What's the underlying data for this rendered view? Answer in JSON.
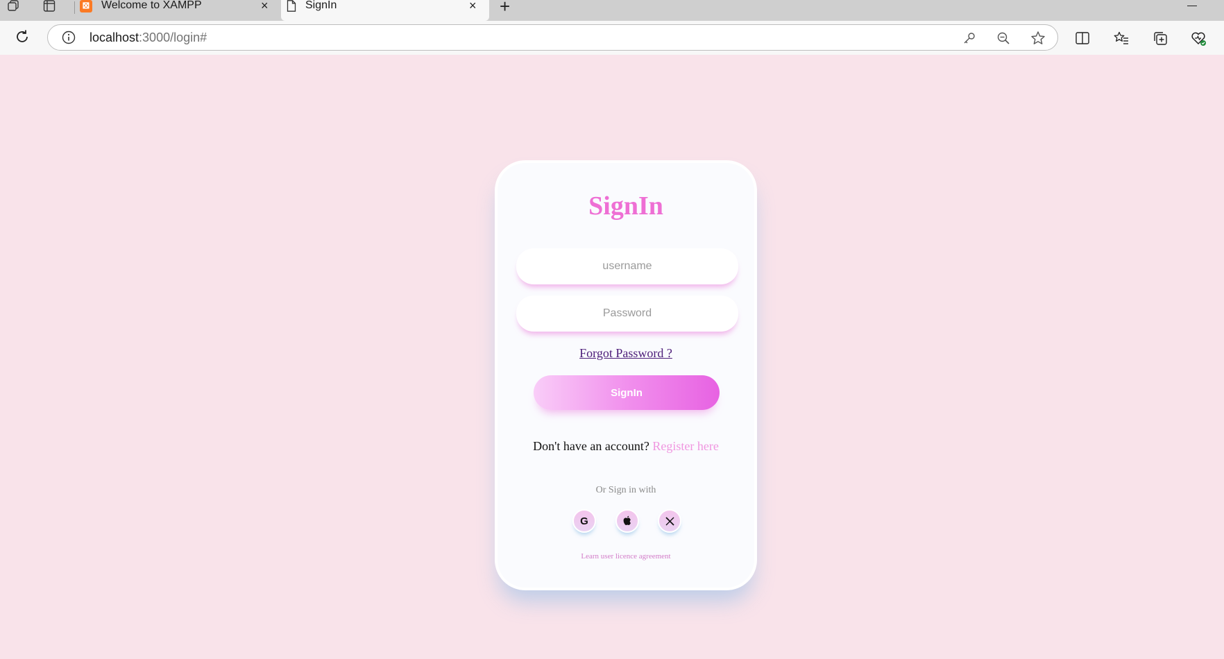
{
  "browser": {
    "tabs": [
      {
        "title": "Welcome to XAMPP",
        "favicon": "xampp-logo",
        "logo_glyph": "⊠"
      },
      {
        "title": "SignIn",
        "favicon": "document-icon"
      }
    ],
    "url": {
      "host": "localhost",
      "path": ":3000/login#"
    }
  },
  "page": {
    "background": "#f9e3ea",
    "accent": "#ee6fd4",
    "title": "SignIn",
    "username_placeholder": "username",
    "password_placeholder": "Password",
    "forgot_label": "Forgot Password ?",
    "signin_label": "SignIn",
    "no_account_text": "Don't have an account?",
    "register_label": "Register here",
    "or_sign_in_text": "Or Sign in with",
    "social": [
      {
        "name": "google-icon",
        "glyph": "G"
      },
      {
        "name": "apple-icon"
      },
      {
        "name": "x-icon",
        "glyph": "𝕏"
      }
    ],
    "licence_label": "Learn user licence agreement"
  }
}
